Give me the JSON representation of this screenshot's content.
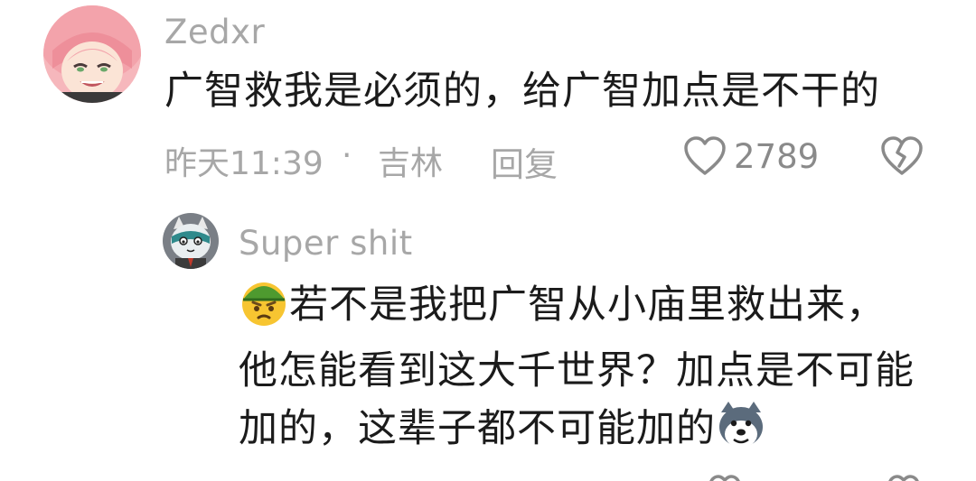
{
  "comment": {
    "username": "Zedxr",
    "text": "广智救我是必须的，给广智加点是不干的",
    "time": "昨天11:39",
    "separator": "·",
    "location": "吉林",
    "reply_label": "回复",
    "like_count": "2789",
    "avatar_icon": "anime-girl-avatar",
    "like_icon": "heart-outline-icon",
    "dislike_icon": "broken-heart-icon"
  },
  "reply": {
    "username": "Super shit",
    "lines": [
      "若不是我把广智从小庙里救出来，",
      "他怎能看到这大千世界？加点是不可能",
      "加的，这辈子都不可能加的"
    ],
    "lead_emoji": "soldier-emoji-icon",
    "trail_emoji": "doge-emoji-icon",
    "avatar_icon": "cartoon-cat-avatar"
  },
  "colors": {
    "text": "#1b1b1b",
    "muted": "#a7a7a7",
    "icon": "#8a8a8a"
  }
}
